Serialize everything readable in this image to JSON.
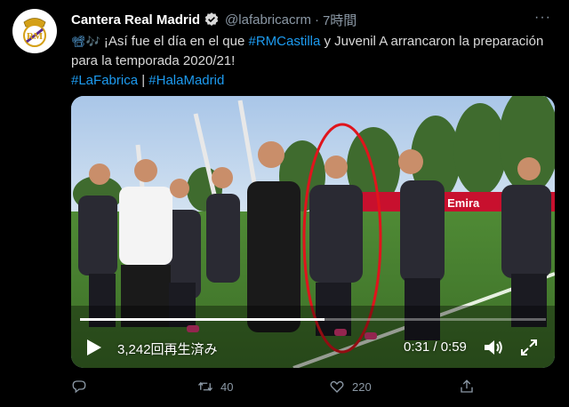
{
  "tweet": {
    "author_name": "Cantera Real Madrid",
    "handle": "@lafabricacrm",
    "separator": "·",
    "time": "7時間",
    "more": "···",
    "emoji": "📽🎶",
    "text_1": " ¡Así fue el día en el que ",
    "hashtag_1": "#RMCastilla",
    "text_2": " y Juvenil A arrancaron la preparación para la temporada 2020/21!",
    "hashtag_2": "#LaFabrica",
    "pipe": " | ",
    "hashtag_3": "#HalaMadrid"
  },
  "video": {
    "views": "3,242回再生済み",
    "timecode": "0:31 / 0:59",
    "progress": 0.525,
    "banner_text": "Fly Emira"
  },
  "actions": {
    "reply_count": "",
    "retweet_count": "40",
    "like_count": "220"
  },
  "colors": {
    "background": "#000000",
    "link": "#1d9bf0",
    "muted": "#8b98a5",
    "annotation_circle": "#e0141c"
  },
  "icons": [
    "verified-badge-icon",
    "play-icon",
    "volume-icon",
    "fullscreen-icon",
    "reply-icon",
    "retweet-icon",
    "like-icon",
    "share-icon"
  ]
}
